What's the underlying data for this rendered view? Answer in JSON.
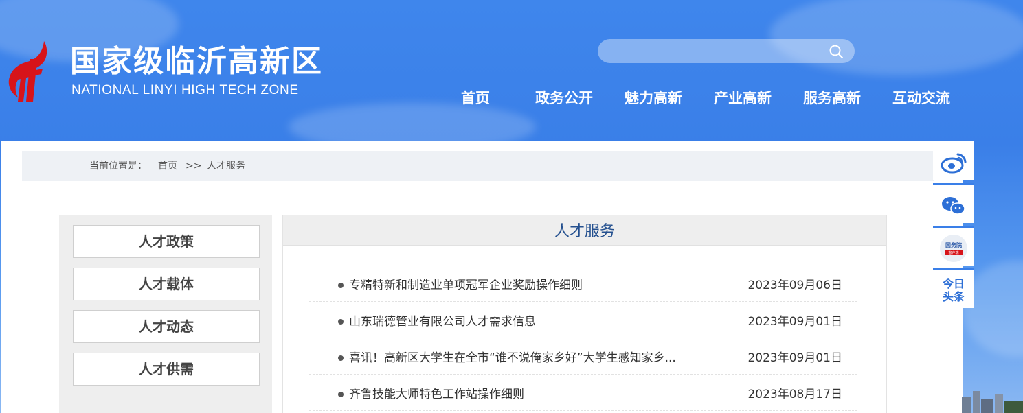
{
  "header": {
    "title": "国家级临沂高新区",
    "subtitle": "NATIONAL LINYI HIGH TECH ZONE",
    "search_placeholder": ""
  },
  "nav": [
    "首页",
    "政务公开",
    "魅力高新",
    "产业高新",
    "服务高新",
    "互动交流"
  ],
  "breadcrumb": {
    "label": "当前位置是：",
    "home": "首页",
    "separator": ">>",
    "current": "人才服务"
  },
  "sidebar": [
    "人才政策",
    "人才载体",
    "人才动态",
    "人才供需"
  ],
  "content": {
    "title": "人才服务",
    "items": [
      {
        "title": "专精特新和制造业单项冠军企业奖励操作细则",
        "date": "2023年09月06日"
      },
      {
        "title": "山东瑞德管业有限公司人才需求信息",
        "date": "2023年09月01日"
      },
      {
        "title": "喜讯！高新区大学生在全市“谁不说俺家乡好”大学生感知家乡...",
        "date": "2023年09月01日"
      },
      {
        "title": "齐鲁技能大师特色工作站操作细则",
        "date": "2023年08月17日"
      }
    ]
  },
  "share": {
    "items": [
      "weibo-icon",
      "wechat-icon",
      "gov-council-icon",
      "toutiao-icon"
    ],
    "toutiao": [
      "今日",
      "头条"
    ],
    "gov_label": [
      "国务院",
      "客户端"
    ]
  },
  "colors": {
    "accent": "#3a7fe8",
    "title_blue": "#24508f",
    "logo_red": "#d7141a"
  }
}
